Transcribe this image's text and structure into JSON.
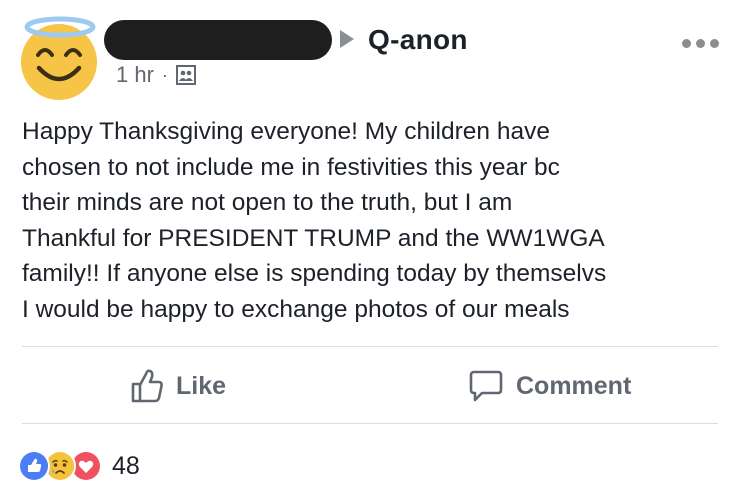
{
  "post": {
    "group_name": "Q-anon",
    "timestamp": "1 hr",
    "separator": "·",
    "audience_icon": "group-icon",
    "body": "Happy Thanksgiving everyone! My children have\nchosen to not include me in festivities this year bc\ntheir minds are not open to the truth, but I am\nThankful for PRESIDENT TRUMP and the WW1WGA\nfamily!! If anyone else is spending today by themselvs\nI would be happy to exchange photos of our meals"
  },
  "actions": {
    "like_label": "Like",
    "comment_label": "Comment"
  },
  "reactions": {
    "count": "48",
    "types": [
      "like",
      "sad",
      "love"
    ]
  },
  "colors": {
    "like_blue": "#4b7ef5",
    "love_red": "#f0515e",
    "avatar_yellow": "#f7c843",
    "halo_blue": "#9ec9f0",
    "muted_text": "#606770"
  }
}
